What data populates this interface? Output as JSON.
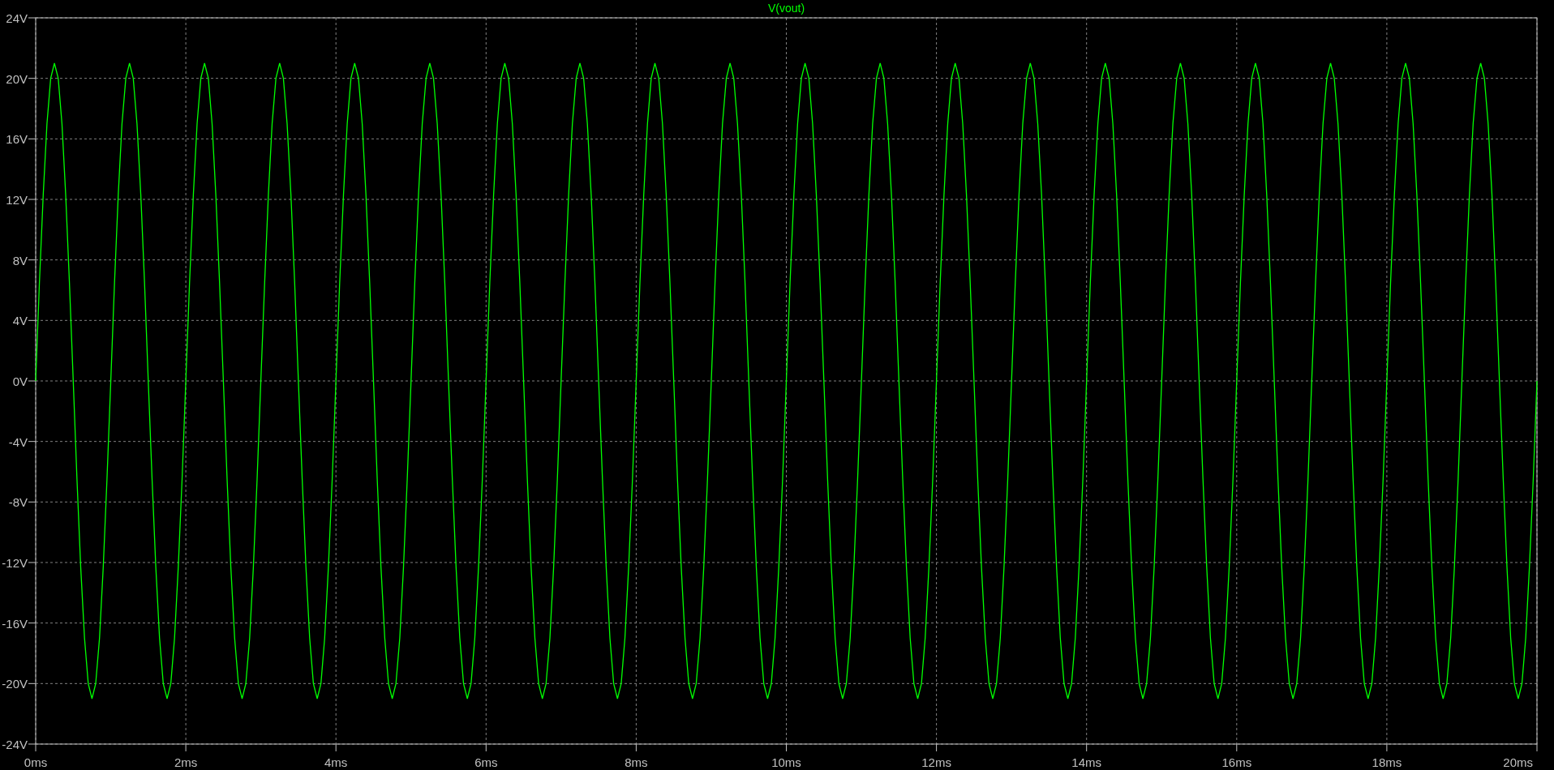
{
  "plot": {
    "chart_data": {
      "type": "line",
      "grid": true,
      "xlim": [
        0,
        20
      ],
      "ylim": [
        -24,
        24
      ],
      "xticks": [
        {
          "value": 0,
          "label": "0ms"
        },
        {
          "value": 2,
          "label": "2ms"
        },
        {
          "value": 4,
          "label": "4ms"
        },
        {
          "value": 6,
          "label": "6ms"
        },
        {
          "value": 8,
          "label": "8ms"
        },
        {
          "value": 10,
          "label": "10ms"
        },
        {
          "value": 12,
          "label": "12ms"
        },
        {
          "value": 14,
          "label": "14ms"
        },
        {
          "value": 16,
          "label": "16ms"
        },
        {
          "value": 18,
          "label": "18ms"
        },
        {
          "value": 20,
          "label": "20ms"
        }
      ],
      "yticks": [
        {
          "value": 24,
          "label": "24V"
        },
        {
          "value": 20,
          "label": "20V"
        },
        {
          "value": 16,
          "label": "16V"
        },
        {
          "value": 12,
          "label": "12V"
        },
        {
          "value": 8,
          "label": "8V"
        },
        {
          "value": 4,
          "label": "4V"
        },
        {
          "value": 0,
          "label": "0V"
        },
        {
          "value": -4,
          "label": "-4V"
        },
        {
          "value": -8,
          "label": "-8V"
        },
        {
          "value": -12,
          "label": "-12V"
        },
        {
          "value": -16,
          "label": "-16V"
        },
        {
          "value": -20,
          "label": "-20V"
        },
        {
          "value": -24,
          "label": "-24V"
        }
      ],
      "x": [
        0,
        0.05,
        0.1,
        0.15,
        0.2,
        0.25,
        0.3,
        0.35,
        0.4,
        0.45,
        0.5,
        0.55,
        0.6,
        0.65,
        0.7,
        0.75,
        0.8,
        0.85,
        0.9,
        0.95,
        1,
        1.05,
        1.1,
        1.15,
        1.2,
        1.25,
        1.3,
        1.35,
        1.4,
        1.45,
        1.5,
        1.55,
        1.6,
        1.65,
        1.7,
        1.75,
        1.8,
        1.85,
        1.9,
        1.95,
        2,
        2.05,
        2.1,
        2.15,
        2.2,
        2.25,
        2.3,
        2.35,
        2.4,
        2.45,
        2.5,
        2.55,
        2.6,
        2.65,
        2.7,
        2.75,
        2.8,
        2.85,
        2.9,
        2.95,
        3,
        3.05,
        3.1,
        3.15,
        3.2,
        3.25,
        3.3,
        3.35,
        3.4,
        3.45,
        3.5,
        3.55,
        3.6,
        3.65,
        3.7,
        3.75,
        3.8,
        3.85,
        3.9,
        3.95,
        4,
        4.05,
        4.1,
        4.15,
        4.2,
        4.25,
        4.3,
        4.35,
        4.4,
        4.45,
        4.5,
        4.55,
        4.6,
        4.65,
        4.7,
        4.75,
        4.8,
        4.85,
        4.9,
        4.95,
        5,
        5.05,
        5.1,
        5.15,
        5.2,
        5.25,
        5.3,
        5.35,
        5.4,
        5.45,
        5.5,
        5.55,
        5.6,
        5.65,
        5.7,
        5.75,
        5.8,
        5.85,
        5.9,
        5.95,
        6,
        6.05,
        6.1,
        6.15,
        6.2,
        6.25,
        6.3,
        6.35,
        6.4,
        6.45,
        6.5,
        6.55,
        6.6,
        6.65,
        6.7,
        6.75,
        6.8,
        6.85,
        6.9,
        6.95,
        7,
        7.05,
        7.1,
        7.15,
        7.2,
        7.25,
        7.3,
        7.35,
        7.4,
        7.45,
        7.5,
        7.55,
        7.6,
        7.65,
        7.7,
        7.75,
        7.8,
        7.85,
        7.9,
        7.95,
        8,
        8.05,
        8.1,
        8.15,
        8.2,
        8.25,
        8.3,
        8.35,
        8.4,
        8.45,
        8.5,
        8.55,
        8.6,
        8.65,
        8.7,
        8.75,
        8.8,
        8.85,
        8.9,
        8.95,
        9,
        9.05,
        9.1,
        9.15,
        9.2,
        9.25,
        9.3,
        9.35,
        9.4,
        9.45,
        9.5,
        9.55,
        9.6,
        9.65,
        9.7,
        9.75,
        9.8,
        9.85,
        9.9,
        9.95,
        10,
        10.05,
        10.1,
        10.15,
        10.2,
        10.25,
        10.3,
        10.35,
        10.4,
        10.45,
        10.5,
        10.55,
        10.6,
        10.65,
        10.7,
        10.75,
        10.8,
        10.85,
        10.9,
        10.95,
        11,
        11.05,
        11.1,
        11.15,
        11.2,
        11.25,
        11.3,
        11.35,
        11.4,
        11.45,
        11.5,
        11.55,
        11.6,
        11.65,
        11.7,
        11.75,
        11.8,
        11.85,
        11.9,
        11.95,
        12,
        12.05,
        12.1,
        12.15,
        12.2,
        12.25,
        12.3,
        12.35,
        12.4,
        12.45,
        12.5,
        12.55,
        12.6,
        12.65,
        12.7,
        12.75,
        12.8,
        12.85,
        12.9,
        12.95,
        13,
        13.05,
        13.1,
        13.15,
        13.2,
        13.25,
        13.3,
        13.35,
        13.4,
        13.45,
        13.5,
        13.55,
        13.6,
        13.65,
        13.7,
        13.75,
        13.8,
        13.85,
        13.9,
        13.95,
        14,
        14.05,
        14.1,
        14.15,
        14.2,
        14.25,
        14.3,
        14.35,
        14.4,
        14.45,
        14.5,
        14.55,
        14.6,
        14.65,
        14.7,
        14.75,
        14.8,
        14.85,
        14.9,
        14.95,
        15,
        15.05,
        15.1,
        15.15,
        15.2,
        15.25,
        15.3,
        15.35,
        15.4,
        15.45,
        15.5,
        15.55,
        15.6,
        15.65,
        15.7,
        15.75,
        15.8,
        15.85,
        15.9,
        15.95,
        16,
        16.05,
        16.1,
        16.15,
        16.2,
        16.25,
        16.3,
        16.35,
        16.4,
        16.45,
        16.5,
        16.55,
        16.6,
        16.65,
        16.7,
        16.75,
        16.8,
        16.85,
        16.9,
        16.95,
        17,
        17.05,
        17.1,
        17.15,
        17.2,
        17.25,
        17.3,
        17.35,
        17.4,
        17.45,
        17.5,
        17.55,
        17.6,
        17.65,
        17.7,
        17.75,
        17.8,
        17.85,
        17.9,
        17.95,
        18,
        18.05,
        18.1,
        18.15,
        18.2,
        18.25,
        18.3,
        18.35,
        18.4,
        18.45,
        18.5,
        18.55,
        18.6,
        18.65,
        18.7,
        18.75,
        18.8,
        18.85,
        18.9,
        18.95,
        19,
        19.05,
        19.1,
        19.15,
        19.2,
        19.25,
        19.3,
        19.35,
        19.4,
        19.45,
        19.5,
        19.55,
        19.6,
        19.65,
        19.7,
        19.75,
        19.8,
        19.85,
        19.9,
        19.95,
        20
      ],
      "series": [
        {
          "name": "V(vout)",
          "color": "#00ff00",
          "values": [
            0,
            6.5,
            12.3,
            17,
            20,
            21,
            20,
            17,
            12.3,
            6.5,
            0,
            -6.5,
            -12.3,
            -17,
            -20,
            -21,
            -20,
            -17,
            -12.3,
            -6.5,
            0,
            6.5,
            12.3,
            17,
            20,
            21,
            20,
            17,
            12.3,
            6.5,
            0,
            -6.5,
            -12.3,
            -17,
            -20,
            -21,
            -20,
            -17,
            -12.3,
            -6.5,
            0,
            6.5,
            12.3,
            17,
            20,
            21,
            20,
            17,
            12.3,
            6.5,
            0,
            -6.5,
            -12.3,
            -17,
            -20,
            -21,
            -20,
            -17,
            -12.3,
            -6.5,
            0,
            6.5,
            12.3,
            17,
            20,
            21,
            20,
            17,
            12.3,
            6.5,
            0,
            -6.5,
            -12.3,
            -17,
            -20,
            -21,
            -20,
            -17,
            -12.3,
            -6.5,
            0,
            6.5,
            12.3,
            17,
            20,
            21,
            20,
            17,
            12.3,
            6.5,
            0,
            -6.5,
            -12.3,
            -17,
            -20,
            -21,
            -20,
            -17,
            -12.3,
            -6.5,
            0,
            6.5,
            12.3,
            17,
            20,
            21,
            20,
            17,
            12.3,
            6.5,
            0,
            -6.5,
            -12.3,
            -17,
            -20,
            -21,
            -20,
            -17,
            -12.3,
            -6.5,
            0,
            6.5,
            12.3,
            17,
            20,
            21,
            20,
            17,
            12.3,
            6.5,
            0,
            -6.5,
            -12.3,
            -17,
            -20,
            -21,
            -20,
            -17,
            -12.3,
            -6.5,
            0,
            6.5,
            12.3,
            17,
            20,
            21,
            20,
            17,
            12.3,
            6.5,
            0,
            -6.5,
            -12.3,
            -17,
            -20,
            -21,
            -20,
            -17,
            -12.3,
            -6.5,
            0,
            6.5,
            12.3,
            17,
            20,
            21,
            20,
            17,
            12.3,
            6.5,
            0,
            -6.5,
            -12.3,
            -17,
            -20,
            -21,
            -20,
            -17,
            -12.3,
            -6.5,
            0,
            6.5,
            12.3,
            17,
            20,
            21,
            20,
            17,
            12.3,
            6.5,
            0,
            -6.5,
            -12.3,
            -17,
            -20,
            -21,
            -20,
            -17,
            -12.3,
            -6.5,
            0,
            6.5,
            12.3,
            17,
            20,
            21,
            20,
            17,
            12.3,
            6.5,
            0,
            -6.5,
            -12.3,
            -17,
            -20,
            -21,
            -20,
            -17,
            -12.3,
            -6.5,
            0,
            6.5,
            12.3,
            17,
            20,
            21,
            20,
            17,
            12.3,
            6.5,
            0,
            -6.5,
            -12.3,
            -17,
            -20,
            -21,
            -20,
            -17,
            -12.3,
            -6.5,
            0,
            6.5,
            12.3,
            17,
            20,
            21,
            20,
            17,
            12.3,
            6.5,
            0,
            -6.5,
            -12.3,
            -17,
            -20,
            -21,
            -20,
            -17,
            -12.3,
            -6.5,
            0,
            6.5,
            12.3,
            17,
            20,
            21,
            20,
            17,
            12.3,
            6.5,
            0,
            -6.5,
            -12.3,
            -17,
            -20,
            -21,
            -20,
            -17,
            -12.3,
            -6.5,
            0,
            6.5,
            12.3,
            17,
            20,
            21,
            20,
            17,
            12.3,
            6.5,
            0,
            -6.5,
            -12.3,
            -17,
            -20,
            -21,
            -20,
            -17,
            -12.3,
            -6.5,
            0,
            6.5,
            12.3,
            17,
            20,
            21,
            20,
            17,
            12.3,
            6.5,
            0,
            -6.5,
            -12.3,
            -17,
            -20,
            -21,
            -20,
            -17,
            -12.3,
            -6.5,
            0,
            6.5,
            12.3,
            17,
            20,
            21,
            20,
            17,
            12.3,
            6.5,
            0,
            -6.5,
            -12.3,
            -17,
            -20,
            -21,
            -20,
            -17,
            -12.3,
            -6.5,
            0,
            6.5,
            12.3,
            17,
            20,
            21,
            20,
            17,
            12.3,
            6.5,
            0,
            -6.5,
            -12.3,
            -17,
            -20,
            -21,
            -20,
            -17,
            -12.3,
            -6.5,
            0,
            6.5,
            12.3,
            17,
            20,
            21,
            20,
            17,
            12.3,
            6.5,
            0,
            -6.5,
            -12.3,
            -17,
            -20,
            -21,
            -20,
            -17,
            -12.3,
            -6.5,
            0,
            6.5,
            12.3,
            17,
            20,
            21,
            20,
            17,
            12.3,
            6.5,
            0,
            -6.5,
            -12.3,
            -17,
            -20,
            -21,
            -20,
            -17,
            -12.3,
            -6.5,
            0
          ]
        }
      ]
    }
  }
}
